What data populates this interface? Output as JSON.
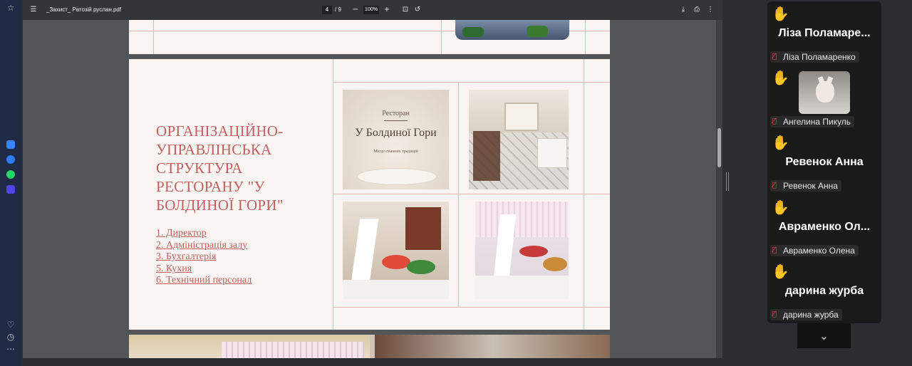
{
  "pdf": {
    "filename": "_Захист_ Ратозій руслан.pdf",
    "page_current": "4",
    "page_total": "/ 9",
    "zoom": "100%"
  },
  "slide": {
    "title": "ОРГАНІЗАЦІЙНО-УПРАВЛІНСЬКА СТРУКТУРА РЕСТОРАНУ \"У БОЛДИНОЇ ГОРИ\"",
    "list": [
      "1. Директор",
      "2. Адміністрація залу",
      "3. Бухгалтерія",
      "5. Кухня",
      "6. Технічний персонал"
    ],
    "logo_small": "Ресторан",
    "logo_big": "У Болдиної Гори",
    "logo_tagline": "Місце смачних традицій"
  },
  "participants": [
    {
      "display": "Ліза  Поламаре...",
      "label": "Ліза Поламаренко",
      "has_video": false
    },
    {
      "display": "",
      "label": "Ангелина Пикуль",
      "has_video": true
    },
    {
      "display": "Ревенок Анна",
      "label": "Ревенок Анна",
      "has_video": false
    },
    {
      "display": "Авраменко  Ол...",
      "label": "Авраменко Олена",
      "has_video": false
    },
    {
      "display": "дарина журба",
      "label": "дарина журба",
      "has_video": false
    }
  ],
  "icons": {
    "hand": "raised-hand-icon",
    "mic": "mic-off-icon"
  },
  "colors": {
    "slide_accent": "#c1615e",
    "slide_bg": "#faf4f3",
    "hand": "#f5c242",
    "mic_off": "#e0443e"
  }
}
